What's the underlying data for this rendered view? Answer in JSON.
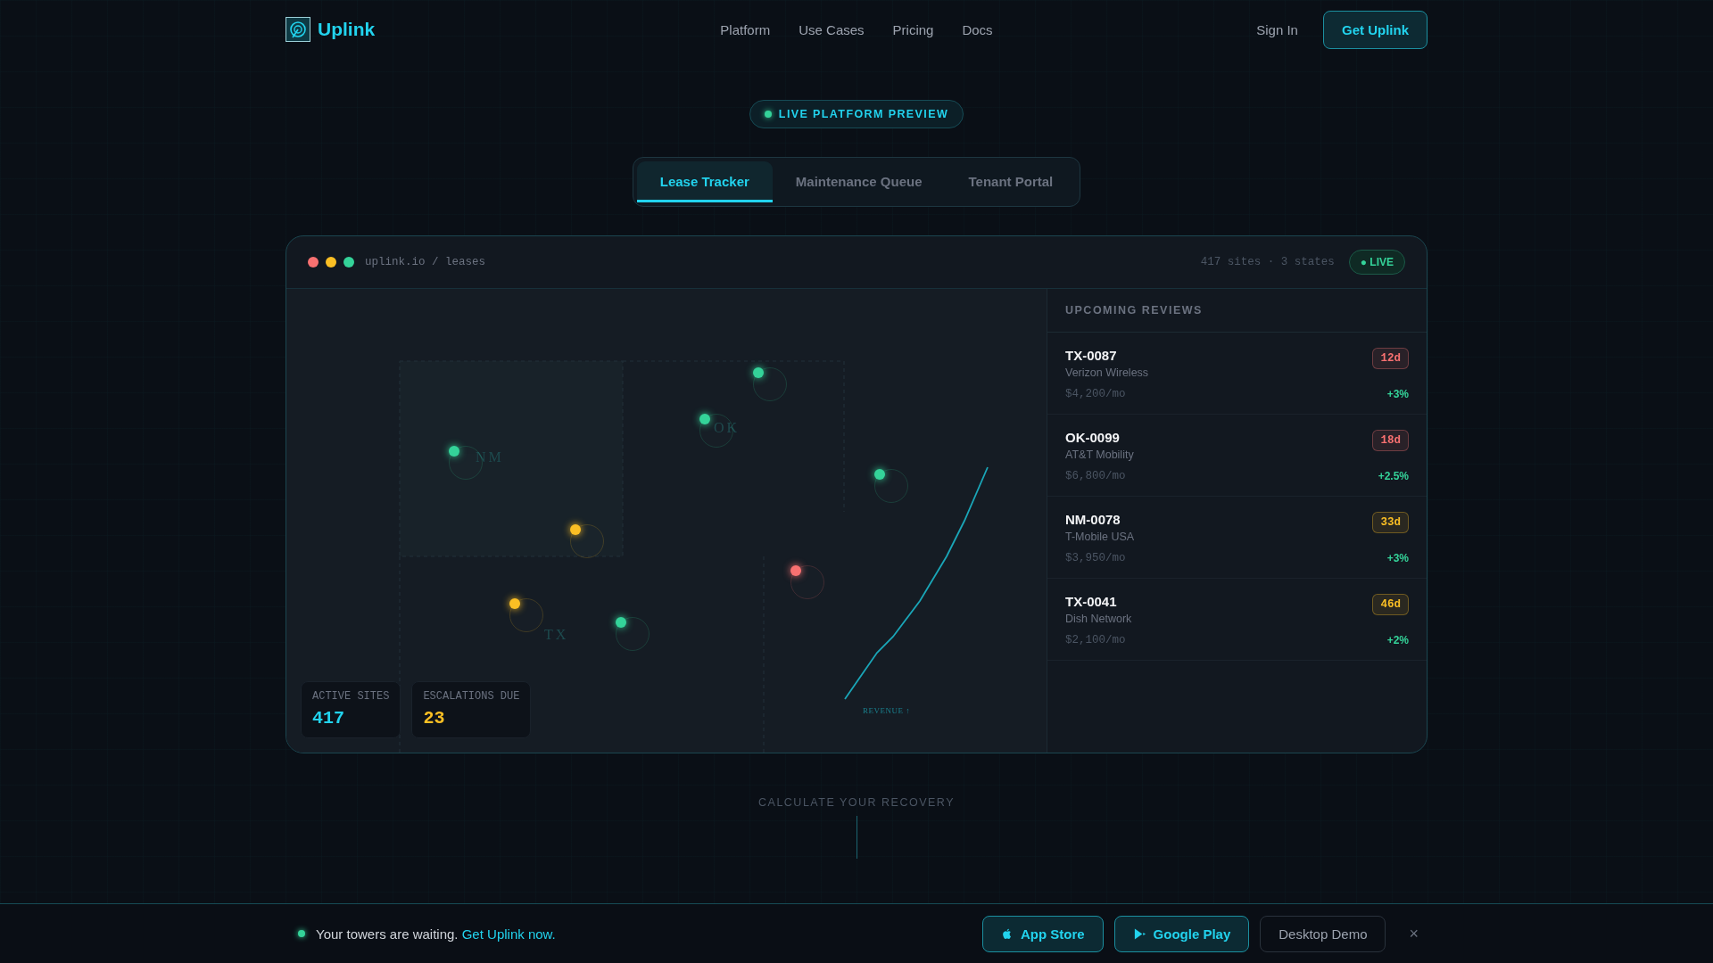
{
  "nav": {
    "logo": "Uplink",
    "links": [
      "Platform",
      "Use Cases",
      "Pricing",
      "Docs"
    ],
    "sign_in": "Sign In",
    "cta": "Get Uplink"
  },
  "badge": "LIVE PLATFORM PREVIEW",
  "tabs": [
    {
      "label": "Lease Tracker",
      "selected": true
    },
    {
      "label": "Maintenance Queue",
      "selected": false
    },
    {
      "label": "Tenant Portal",
      "selected": false
    }
  ],
  "window": {
    "path": "uplink.io / leases",
    "summary": "417 sites · 3 states",
    "live": "● LIVE"
  },
  "map": {
    "states": [
      "NM",
      "OK",
      "TX"
    ],
    "sites": [
      {
        "color": "#34d399"
      },
      {
        "color": "#34d399"
      },
      {
        "color": "#34d399"
      },
      {
        "color": "#34d399"
      },
      {
        "color": "#fbbf24"
      },
      {
        "color": "#f87171"
      },
      {
        "color": "#fbbf24"
      },
      {
        "color": "#34d399"
      }
    ],
    "revenue_label": "REVENUE ↑",
    "stats": [
      {
        "label": "ACTIVE SITES",
        "value": "417",
        "color": "#22d3ee"
      },
      {
        "label": "ESCALATIONS DUE",
        "value": "23",
        "color": "#fbbf24"
      }
    ]
  },
  "reviews": {
    "title": "UPCOMING REVIEWS",
    "items": [
      {
        "site": "TX-0087",
        "tenant": "Verizon Wireless",
        "rent": "$4,200/mo",
        "due": "12d",
        "color": "#f87171",
        "change": "+3%"
      },
      {
        "site": "OK-0099",
        "tenant": "AT&T Mobility",
        "rent": "$6,800/mo",
        "due": "18d",
        "color": "#f87171",
        "change": "+2.5%"
      },
      {
        "site": "NM-0078",
        "tenant": "T-Mobile USA",
        "rent": "$3,950/mo",
        "due": "33d",
        "color": "#fbbf24",
        "change": "+3%"
      },
      {
        "site": "TX-0041",
        "tenant": "Dish Network",
        "rent": "$2,100/mo",
        "due": "46d",
        "color": "#fbbf24",
        "change": "+2%"
      }
    ]
  },
  "section_label": "CALCULATE YOUR RECOVERY",
  "banner": {
    "text": "Your towers are waiting.",
    "link": "Get Uplink now.",
    "buttons": [
      {
        "label": "App Store",
        "kind": "apple"
      },
      {
        "label": "Google Play",
        "kind": "play"
      },
      {
        "label": "Desktop Demo",
        "kind": "plain"
      }
    ],
    "close": "×"
  }
}
